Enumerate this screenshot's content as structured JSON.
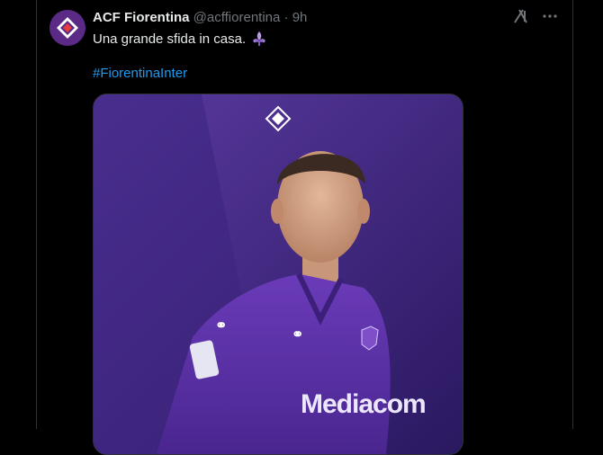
{
  "tweet": {
    "author_name": "ACF Fiorentina",
    "author_handle": "@acffiorentina",
    "separator": "·",
    "time": "9h",
    "text": "Una grande sfida in casa.",
    "hashtag": "#FiorentinaInter",
    "jersey_brand": "Mediacom"
  },
  "icons": [
    "grok-icon",
    "more-icon",
    "fleur-de-lis-icon",
    "fiorentina-logo-icon"
  ],
  "colors": {
    "background": "#000000",
    "text": "#e7e9ea",
    "muted": "#71767b",
    "link": "#1d9bf0",
    "brand_purple": "#5b2a86"
  }
}
